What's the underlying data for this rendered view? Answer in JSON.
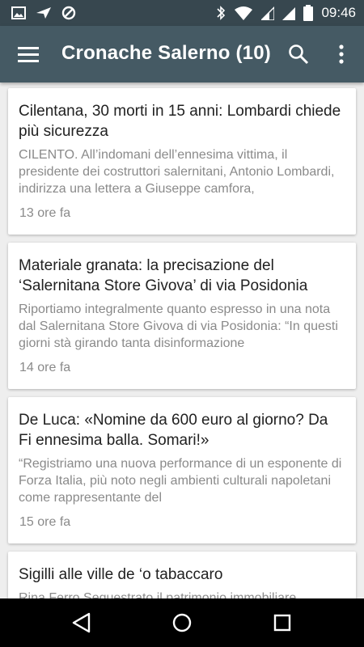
{
  "status_bar": {
    "time": "09:46",
    "left_icons": [
      "image-icon",
      "send-icon",
      "blocked-icon"
    ],
    "right_icons": [
      "bluetooth-icon",
      "wifi-icon",
      "signal-icon",
      "signal-icon",
      "battery-icon"
    ]
  },
  "toolbar": {
    "title": "Cronache Salerno (10)",
    "menu_icon": "hamburger-menu-icon",
    "search_icon": "search-icon",
    "more_icon": "more-vert-icon"
  },
  "articles": [
    {
      "headline": "Cilentana, 30 morti in 15 anni: Lombardi chiede più sicurezza",
      "snippet": "CILENTO. All’indomani dell’ennesima vittima, il presidente dei costruttori salernitani, Antonio Lombardi, indirizza una lettera a Giuseppe camfora,",
      "time": "13 ore fa"
    },
    {
      "headline": "Materiale granata: la precisazione del ‘Salernitana Store Givova’ di via Posidonia",
      "snippet": "Riportiamo integralmente quanto espresso in una nota dal Salernitana Store Givova di via Posidonia: “In questi giorni stà girando tanta disinformazione",
      "time": "14 ore fa"
    },
    {
      "headline": "De Luca: «Nomine da 600 euro al giorno? Da Fi ennesima balla. Somari!»",
      "snippet": "“Registriamo una nuova performance di un esponente di Forza Italia, più noto negli ambienti culturali napoletani come rappresentante del",
      "time": "15 ore fa"
    },
    {
      "headline": "Sigilli alle ville de ‘o tabaccaro",
      "snippet": "Rina Ferro Sequestrato il patrimonio immobiliare",
      "time": ""
    }
  ],
  "nav_bar": {
    "back_icon": "back-triangle-icon",
    "home_icon": "home-circle-icon",
    "recents_icon": "recents-square-icon"
  }
}
